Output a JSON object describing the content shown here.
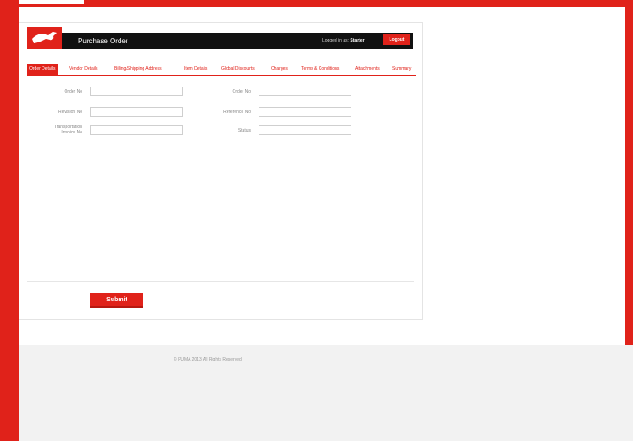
{
  "app": {
    "title": "Purchase Order",
    "logged_in_prefix": "Logged in as:",
    "username": "Starter",
    "logout_label": "Logout"
  },
  "tabs": [
    {
      "label": "Order Details",
      "active": true
    },
    {
      "label": "Vendor Details"
    },
    {
      "label": "Billing/Shipping Address"
    },
    {
      "label": "Item Details"
    },
    {
      "label": "Global Discounts"
    },
    {
      "label": "Charges"
    },
    {
      "label": "Terms & Conditions"
    },
    {
      "label": "Attachments"
    },
    {
      "label": "Summary"
    }
  ],
  "form": {
    "order_no": {
      "label": "Order No",
      "value": ""
    },
    "order_no_2": {
      "label": "Order No",
      "value": ""
    },
    "revision_no": {
      "label": "Revision No",
      "value": ""
    },
    "reference_no": {
      "label": "Reference No",
      "value": ""
    },
    "transportation_invoice_no": {
      "label_line1": "Transportation",
      "label_line2": "Invoice No",
      "value": ""
    },
    "status": {
      "label": "Status",
      "value": ""
    }
  },
  "submit_label": "Submit",
  "footer": {
    "copyright": "© PUMA 2013 All Rights Reserved"
  },
  "colors": {
    "accent": "#e0221a",
    "header_bg": "#111111",
    "footer_bg": "#f2f2f2"
  }
}
